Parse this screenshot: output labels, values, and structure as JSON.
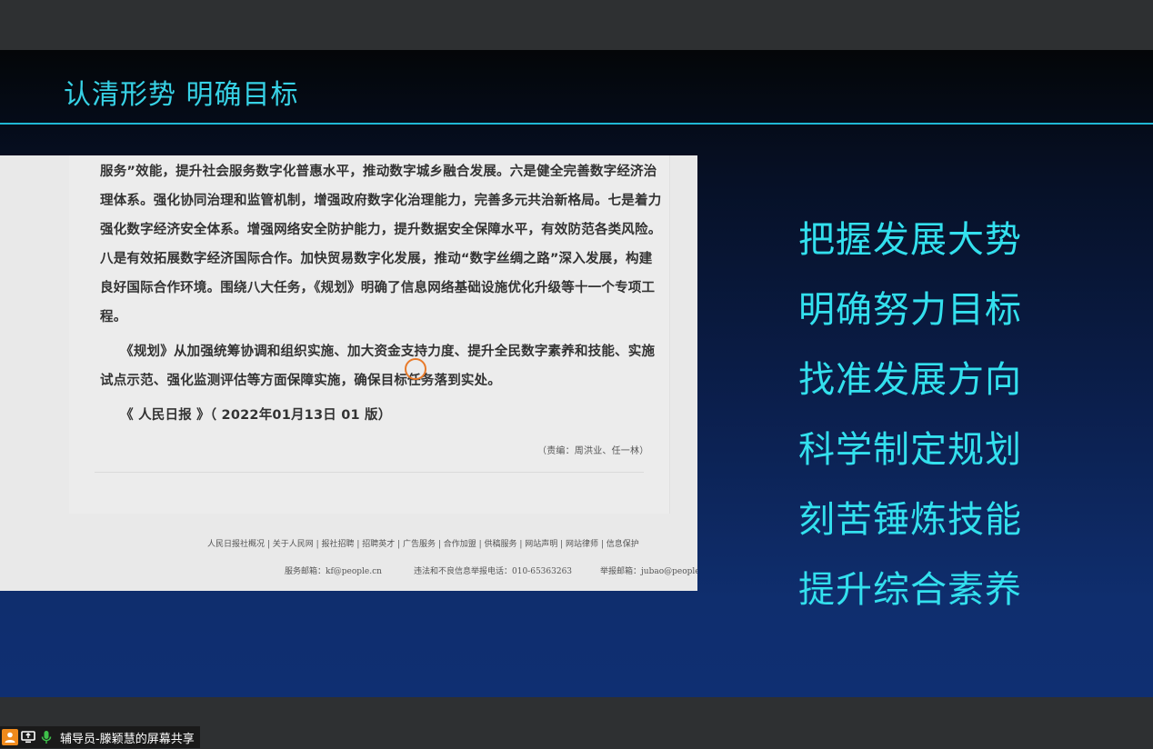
{
  "slide": {
    "title": "认清形势 明确目标",
    "right_items": [
      "把握发展大势",
      "明确努力目标",
      "找准发展方向",
      "科学制定规划",
      "刻苦锤炼技能",
      "提升综合素养"
    ]
  },
  "document": {
    "lines": [
      "服务”效能，提升社会服务数字化普惠水平，推动数字城乡融合发展。六是健全完善数字经济治",
      "理体系。强化协同治理和监管机制，增强政府数字化治理能力，完善多元共治新格局。七是着力",
      "强化数字经济安全体系。增强网络安全防护能力，提升数据安全保障水平，有效防范各类风险。",
      "八是有效拓展数字经济国际合作。加快贸易数字化发展，推动“数字丝绸之路”深入发展，构建",
      "良好国际合作环境。围绕八大任务，《规划》明确了信息网络基础设施优化升级等十一个专项工",
      "程。",
      "　　《规划》从加强统筹协调和组织实施、加大资金支持力度、提升全民数字素养和技能、实施",
      "试点示范、强化监测评估等方面保障实施，确保目标任务落到实处。",
      "　　《 人民日报 》（ 2022年01月13日 01 版）"
    ],
    "editor": "（责编：周洪业、任一林）",
    "footer_links": "人民日报社概况 | 关于人民网 | 报社招聘 | 招聘英才 | 广告服务 | 合作加盟 | 供稿服务 | 网站声明 | 网站律师 | 信息保护",
    "service_email": "服务邮箱：kf@people.cn",
    "report_phone": "违法和不良信息举报电话：010-65363263",
    "report_email": "举报邮箱：jubao@people."
  },
  "share": {
    "label": "辅导员-滕颖慧的屏幕共享",
    "icons": [
      "user-icon",
      "screen-share-icon",
      "microphone-icon"
    ]
  }
}
